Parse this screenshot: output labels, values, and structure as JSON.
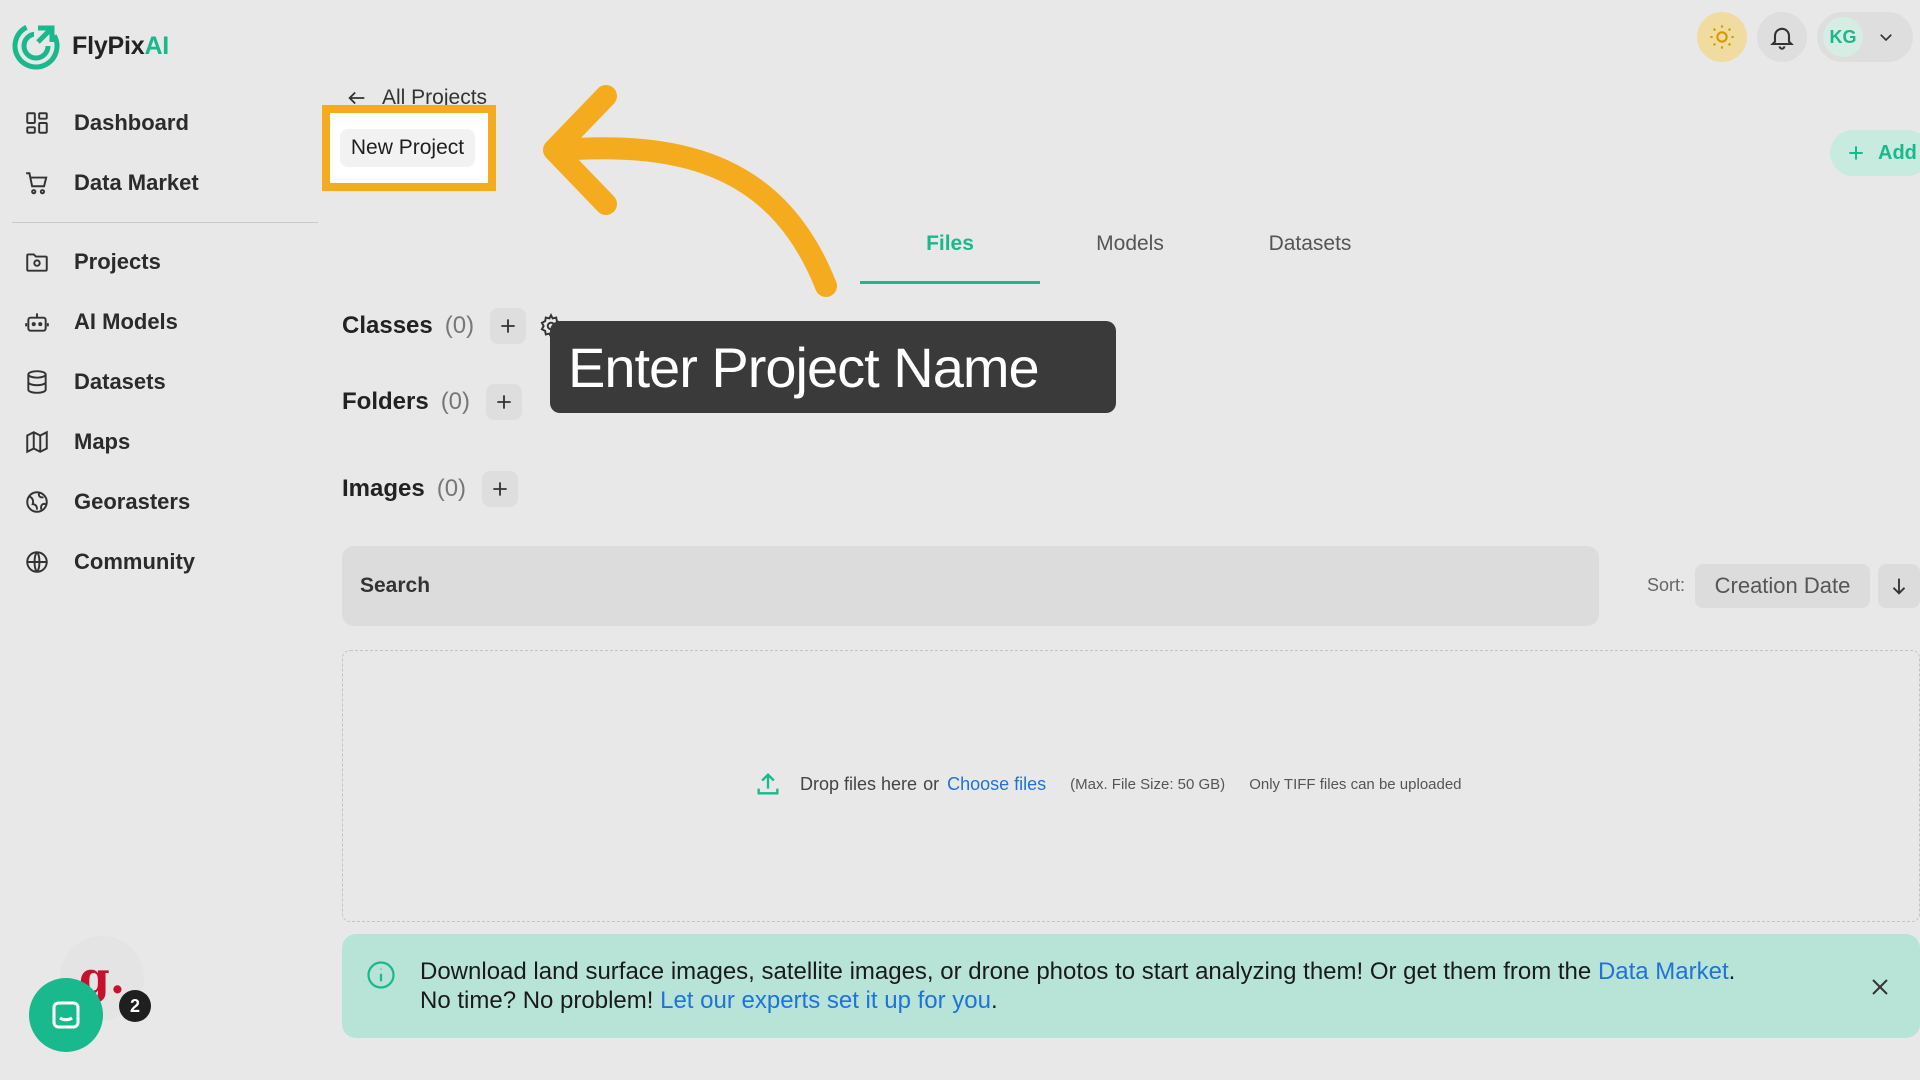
{
  "brand": {
    "name_main": "FlyPix",
    "name_accent": "AI",
    "accent": "#19b88d"
  },
  "sidebar": {
    "items": [
      {
        "label": "Dashboard",
        "icon": "dashboard-icon"
      },
      {
        "label": "Data Market",
        "icon": "cart-icon"
      },
      {
        "label": "Projects",
        "icon": "folder-icon"
      },
      {
        "label": "AI Models",
        "icon": "robot-icon"
      },
      {
        "label": "Datasets",
        "icon": "database-icon"
      },
      {
        "label": "Maps",
        "icon": "map-icon"
      },
      {
        "label": "Georasters",
        "icon": "globe-grid-icon"
      },
      {
        "label": "Community",
        "icon": "globe-icon"
      }
    ]
  },
  "header": {
    "user_initials": "KG"
  },
  "project": {
    "back_label": "All Projects",
    "name": "New Project",
    "add_label": "Add"
  },
  "tabs": [
    {
      "label": "Files",
      "active": true
    },
    {
      "label": "Models",
      "active": false
    },
    {
      "label": "Datasets",
      "active": false
    }
  ],
  "sections": {
    "classes": {
      "title": "Classes",
      "count": "(0)"
    },
    "folders": {
      "title": "Folders",
      "count": "(0)"
    },
    "images": {
      "title": "Images",
      "count": "(0)"
    }
  },
  "tooltip": "Enter Project Name",
  "search": {
    "placeholder": "Search"
  },
  "sort": {
    "label": "Sort:",
    "value": "Creation Date"
  },
  "dropzone": {
    "text": "Drop files here",
    "or": "or",
    "link": "Choose files",
    "max_size": "(Max. File Size: 50 GB)",
    "note": "Only TIFF files can be uploaded"
  },
  "banner": {
    "line1": "Download land surface images, satellite images, or drone photos to start analyzing them! Or get them from the",
    "link1": "Data Market",
    "period1": ".",
    "line2": "No time? No problem!",
    "link2": "Let our experts set it up for you",
    "period2": "."
  },
  "chat": {
    "badge_letter": "g.",
    "count": "2"
  },
  "colors": {
    "highlight": "#f5ab1e",
    "tooltip_bg": "#3a3a3a",
    "link": "#1f72d8",
    "banner_bg": "#b8e4d7"
  }
}
